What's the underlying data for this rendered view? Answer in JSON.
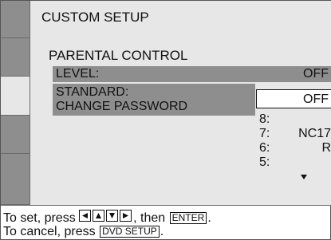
{
  "menu": {
    "title": "CUSTOM SETUP",
    "section": "PARENTAL CONTROL",
    "level_label": "LEVEL:",
    "level_value": "OFF",
    "standard_label": "STANDARD:",
    "change_password_label": "CHANGE PASSWORD"
  },
  "dropdown": {
    "selected": "OFF",
    "options": [
      {
        "num": "8:",
        "value": ""
      },
      {
        "num": "7:",
        "value": "NC17"
      },
      {
        "num": "6:",
        "value": "R"
      },
      {
        "num": "5:",
        "value": ""
      }
    ],
    "scroll_icon": "triangle-down-icon"
  },
  "help": {
    "set_prefix": "To set, press",
    "set_middle": ", then",
    "set_suffix": ".",
    "enter_key": "ENTER",
    "cancel_prefix": "To cancel, press",
    "cancel_suffix": ".",
    "dvd_setup_key": "DVD SETUP",
    "arrow_icons": [
      "arrow-left-icon",
      "arrow-up-icon",
      "arrow-down-icon",
      "arrow-right-icon"
    ]
  },
  "colors": {
    "panel": "#e7e7e7",
    "highlight": "#8e8e8e",
    "text": "#111111"
  }
}
